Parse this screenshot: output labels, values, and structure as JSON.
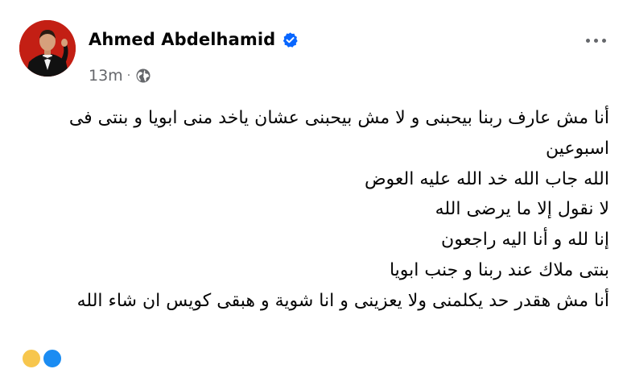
{
  "post": {
    "author": {
      "name": "Ahmed Abdelhamid",
      "verified": true,
      "avatar_icon": "profile-photo"
    },
    "timestamp": "13m",
    "separator": "·",
    "audience_icon": "globe-icon",
    "more_icon": "ellipsis-icon",
    "lines": [
      "أنا مش عارف ربنا بيحبنى و لا مش بيحبنى عشان ياخد منى ابويا و بنتى فى",
      "اسبوعين",
      "الله جاب الله خد الله عليه العوض",
      "لا نقول إلا ما يرضى الله",
      "إنا لله و أنا اليه راجعون",
      "بنتى ملاك عند ربنا و جنب ابويا",
      "أنا مش هقدر حد يكلمنى ولا يعزينى و انا شوية و هبقى كويس ان شاء الله"
    ],
    "reactions": [
      "care",
      "like"
    ]
  },
  "colors": {
    "name_text": "#050505",
    "secondary_text": "#65676b",
    "verified_badge": "#0866ff",
    "avatar_background": "#c31f14"
  }
}
